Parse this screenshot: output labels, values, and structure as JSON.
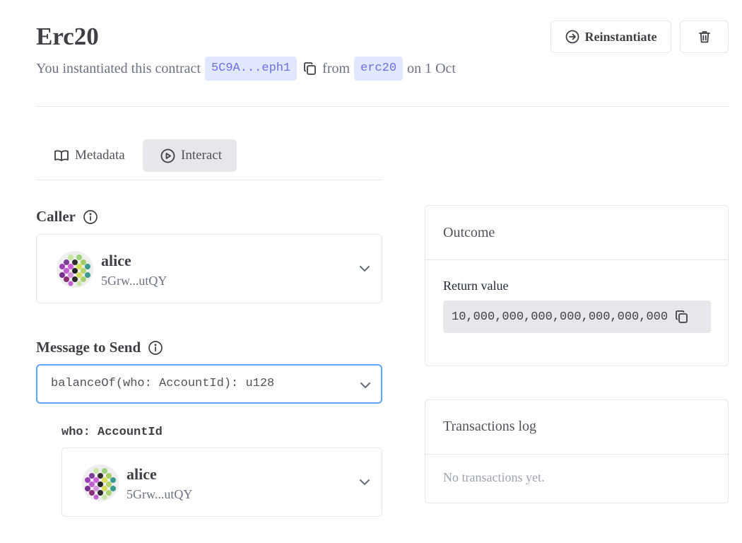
{
  "header": {
    "title": "Erc20",
    "subtitle_prefix": "You instantiated this contract",
    "contract_address": "5C9A...eph1",
    "from_text": "from",
    "code_hash_name": "erc20",
    "date_text": "on 1 Oct",
    "reinstantiate_label": "Reinstantiate"
  },
  "tabs": [
    {
      "label": "Metadata",
      "icon": "book-icon",
      "active": false
    },
    {
      "label": "Interact",
      "icon": "play-circle-icon",
      "active": true
    }
  ],
  "caller": {
    "label": "Caller",
    "account_name": "alice",
    "account_address": "5Grw...utQY"
  },
  "message": {
    "label": "Message to Send",
    "selected": "balanceOf(who: AccountId): u128",
    "arg_label": "who: AccountId",
    "arg_account_name": "alice",
    "arg_account_address": "5Grw...utQY"
  },
  "outcome": {
    "title": "Outcome",
    "return_label": "Return value",
    "return_value": "10,000,000,000,000,000,000,000"
  },
  "transactions": {
    "title": "Transactions log",
    "empty_text": "No transactions yet."
  },
  "colors": {
    "chip_bg": "#e0e7ff",
    "chip_text": "#6d6fe0",
    "focus_border": "#60a5fa",
    "active_tab_bg": "#e5e7eb"
  }
}
